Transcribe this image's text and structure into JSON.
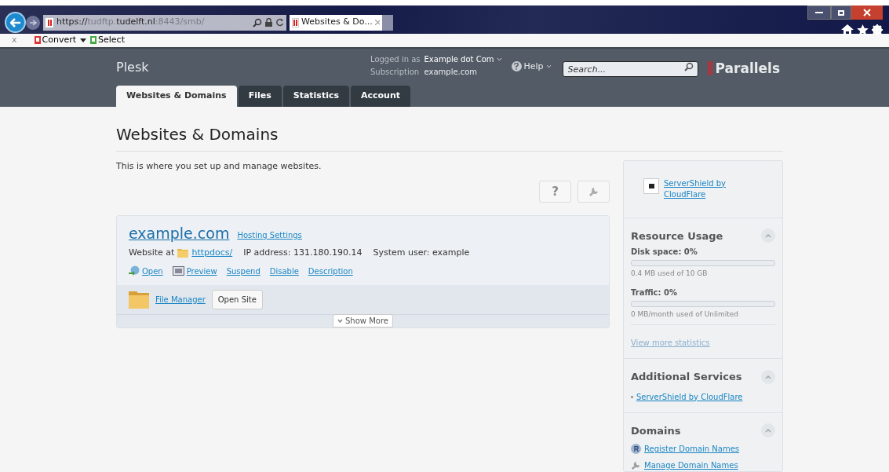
{
  "browser": {
    "url_parts": [
      {
        "text": "https://",
        "strong": true
      },
      {
        "text": "tudftp.",
        "strong": false
      },
      {
        "text": "tudelft.nl",
        "strong": true
      },
      {
        "text": ":8443/smb/",
        "strong": false
      }
    ],
    "tab": {
      "title": "Websites & Do...",
      "selected": true
    },
    "toolbar": {
      "close": "x",
      "items": [
        "Convert",
        "Select"
      ]
    }
  },
  "header": {
    "brand": "Plesk",
    "logged_in_label": "Logged in as",
    "user": "Example dot Com",
    "subscription_label": "Subscription",
    "subscription": "example.com",
    "help": "Help",
    "search": {
      "placeholder": "Search..."
    },
    "logo": "Parallels"
  },
  "tabs": [
    {
      "label": "Websites & Domains",
      "selected": true
    },
    {
      "label": "Files",
      "selected": false
    },
    {
      "label": "Statistics",
      "selected": false
    },
    {
      "label": "Account",
      "selected": false
    }
  ],
  "page": {
    "title": "Websites & Domains",
    "description": "This is where you set up and manage websites.",
    "help_button": "?"
  },
  "domain": {
    "name": "example.com",
    "settings_link": "Hosting Settings",
    "website_at": "Website at",
    "docroot": "httpdocs/",
    "ip": "IP address: 131.180.190.14",
    "user": "System user: example",
    "actions": [
      {
        "label": "Open",
        "kind": "open"
      },
      {
        "label": "Preview",
        "kind": "preview"
      },
      {
        "label": "Suspend",
        "kind": "plain"
      },
      {
        "label": "Disable",
        "kind": "plain"
      },
      {
        "label": "Description",
        "kind": "plain"
      }
    ],
    "file_manager": "File Manager",
    "open_site": "Open Site",
    "show_more": "Show More"
  },
  "sidebar": {
    "promo": "ServerShield by CloudFlare",
    "resource": {
      "title": "Resource Usage",
      "expanded": true,
      "meters": [
        {
          "label": "Disk space: 0%",
          "level": 0,
          "note": "0.4 MB used of 10 GB"
        },
        {
          "label": "Traffic: 0%",
          "level": 0,
          "note": "0 MB/month used of Unlimited"
        }
      ],
      "more": "View more statistics"
    },
    "services": {
      "title": "Additional Services",
      "expanded": true,
      "items": [
        "ServerShield by CloudFlare"
      ]
    },
    "domains": {
      "title": "Domains",
      "expanded": true,
      "items": [
        {
          "label": "Register Domain Names",
          "kind": "register"
        },
        {
          "label": "Manage Domain Names",
          "kind": "manage"
        }
      ]
    }
  }
}
